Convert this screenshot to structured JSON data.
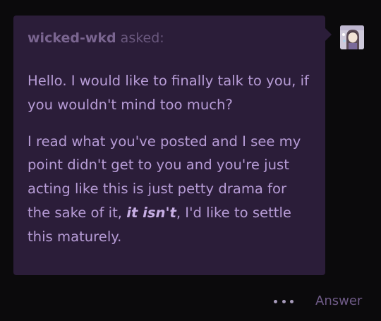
{
  "ask": {
    "asker_name": "wicked-wkd",
    "asker_verb": "asked:",
    "paragraph_1": "Hello. I would like to finally talk to you, if you wouldn't mind too much?",
    "paragraph_2_before": "I read what you've posted and I see my point didn't get to you and you're just acting like this is just petty drama for the sake of it, ",
    "paragraph_2_emphasis": "it isn't",
    "paragraph_2_after": ", I'd like to settle this maturely."
  },
  "footer": {
    "more_icon": "ellipsis-icon",
    "answer_label": "Answer"
  },
  "colors": {
    "page_background": "#0b0a0c",
    "bubble_background": "#2b1d39",
    "question_text": "#b79cd6",
    "asker_text": "#7a6590",
    "answer_text": "#6e5a86"
  }
}
